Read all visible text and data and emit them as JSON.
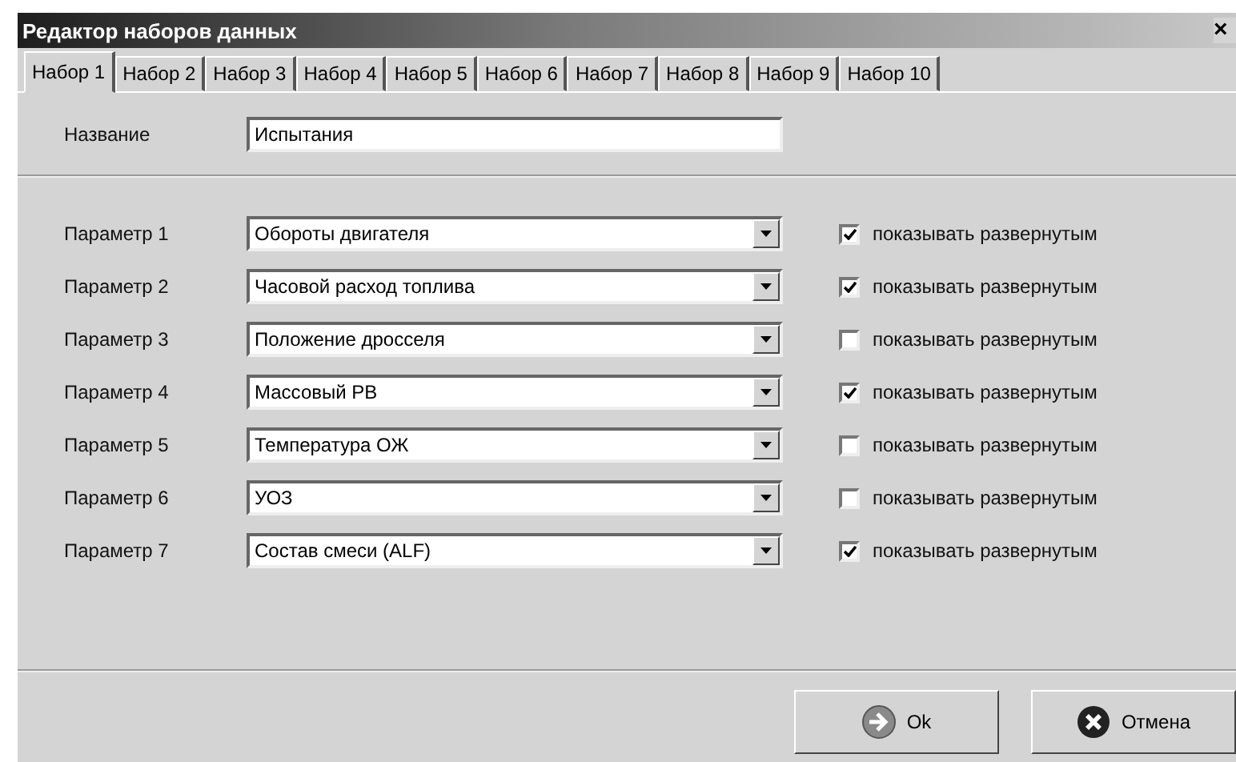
{
  "window": {
    "title": "Редактор наборов данных",
    "close": "×"
  },
  "tabs": [
    {
      "label": "Набор 1",
      "selected": true
    },
    {
      "label": "Набор 2",
      "selected": false
    },
    {
      "label": "Набор 3",
      "selected": false
    },
    {
      "label": "Набор 4",
      "selected": false
    },
    {
      "label": "Набор 5",
      "selected": false
    },
    {
      "label": "Набор 6",
      "selected": false
    },
    {
      "label": "Набор 7",
      "selected": false
    },
    {
      "label": "Набор 8",
      "selected": false
    },
    {
      "label": "Набор 9",
      "selected": false
    },
    {
      "label": "Набор 10",
      "selected": false
    }
  ],
  "name_field": {
    "label": "Название",
    "value": "Испытания"
  },
  "parameters": [
    {
      "label": "Параметр 1",
      "value": "Обороты двигателя",
      "checked": true,
      "checkbox_label": "показывать развернутым"
    },
    {
      "label": "Параметр 2",
      "value": "Часовой расход топлива",
      "checked": true,
      "checkbox_label": "показывать развернутым"
    },
    {
      "label": "Параметр 3",
      "value": "Положение дросселя",
      "checked": false,
      "checkbox_label": "показывать развернутым"
    },
    {
      "label": "Параметр 4",
      "value": "Массовый РВ",
      "checked": true,
      "checkbox_label": "показывать развернутым"
    },
    {
      "label": "Параметр 5",
      "value": "Температура ОЖ",
      "checked": false,
      "checkbox_label": "показывать развернутым"
    },
    {
      "label": "Параметр 6",
      "value": "УОЗ",
      "checked": false,
      "checkbox_label": "показывать развернутым"
    },
    {
      "label": "Параметр 7",
      "value": "Состав смеси (ALF)",
      "checked": true,
      "checkbox_label": "показывать развернутым"
    }
  ],
  "buttons": [
    {
      "kind": "ok",
      "label": "Ok"
    },
    {
      "kind": "cancel",
      "label": "Отмена"
    }
  ]
}
